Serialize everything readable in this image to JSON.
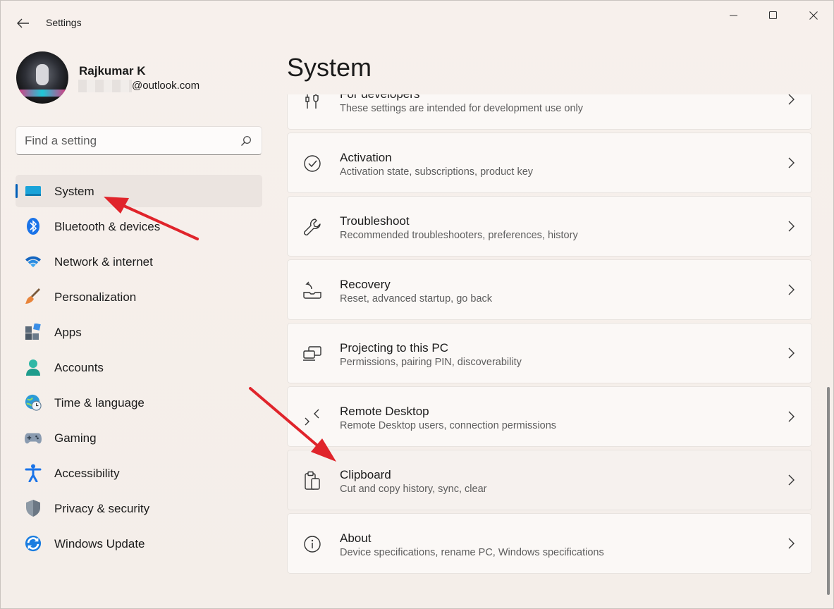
{
  "app": {
    "title": "Settings"
  },
  "profile": {
    "name": "Rajkumar K",
    "email_visible": "@outlook.com"
  },
  "search": {
    "placeholder": "Find a setting"
  },
  "nav": {
    "items": [
      {
        "label": "System",
        "icon": "system-icon",
        "active": true
      },
      {
        "label": "Bluetooth & devices",
        "icon": "bluetooth-icon"
      },
      {
        "label": "Network & internet",
        "icon": "wifi-icon"
      },
      {
        "label": "Personalization",
        "icon": "paintbrush-icon"
      },
      {
        "label": "Apps",
        "icon": "apps-icon"
      },
      {
        "label": "Accounts",
        "icon": "accounts-icon"
      },
      {
        "label": "Time & language",
        "icon": "globe-clock-icon"
      },
      {
        "label": "Gaming",
        "icon": "gamepad-icon"
      },
      {
        "label": "Accessibility",
        "icon": "accessibility-icon"
      },
      {
        "label": "Privacy & security",
        "icon": "shield-icon"
      },
      {
        "label": "Windows Update",
        "icon": "update-icon"
      }
    ]
  },
  "main": {
    "title": "System",
    "cards": [
      {
        "title": "For developers",
        "desc": "These settings are intended for development use only",
        "icon": "developer-tools-icon"
      },
      {
        "title": "Activation",
        "desc": "Activation state, subscriptions, product key",
        "icon": "check-circle-icon"
      },
      {
        "title": "Troubleshoot",
        "desc": "Recommended troubleshooters, preferences, history",
        "icon": "wrench-icon"
      },
      {
        "title": "Recovery",
        "desc": "Reset, advanced startup, go back",
        "icon": "recovery-icon"
      },
      {
        "title": "Projecting to this PC",
        "desc": "Permissions, pairing PIN, discoverability",
        "icon": "projecting-icon"
      },
      {
        "title": "Remote Desktop",
        "desc": "Remote Desktop users, connection permissions",
        "icon": "remote-desktop-icon"
      },
      {
        "title": "Clipboard",
        "desc": "Cut and copy history, sync, clear",
        "icon": "clipboard-icon"
      },
      {
        "title": "About",
        "desc": "Device specifications, rename PC, Windows specifications",
        "icon": "info-icon"
      }
    ]
  },
  "colors": {
    "accent": "#005fb8",
    "annotation": "#e0242b"
  }
}
